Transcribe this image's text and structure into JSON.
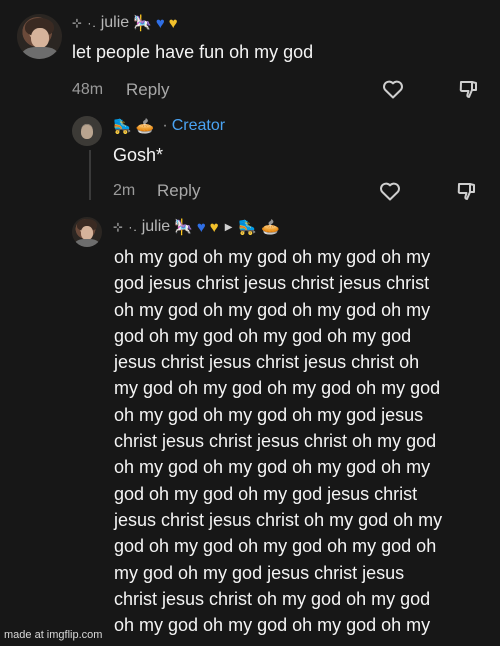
{
  "comments": [
    {
      "username": "julie",
      "badge": "",
      "text": "let people have fun oh my god",
      "time": "48m",
      "reply_label": "Reply"
    },
    {
      "username": "",
      "badge": "Creator",
      "text": "Gosh*",
      "time": "2m",
      "reply_label": "Reply"
    },
    {
      "username": "julie",
      "badge": "",
      "text": "oh my god oh my god oh my god oh my\ngod jesus christ jesus christ jesus christ\noh my god oh my god oh my god oh my\ngod oh my god oh my god oh my god\njesus christ jesus christ jesus christ oh\nmy god oh my god oh my god oh my god\noh my god oh my god oh my god jesus\nchrist jesus christ jesus christ oh my god\noh my god oh my god oh my god oh my\ngod oh my god oh my god jesus christ\njesus christ jesus christ oh my god oh my\ngod oh my god oh my god oh my god oh\nmy god oh my god jesus christ jesus\nchrist jesus christ oh my god oh my god\noh my god oh my god oh my god oh my"
    }
  ],
  "icons": {
    "like": "heart-outline-icon",
    "dislike": "thumbs-down-icon",
    "reply_arrow": "triangle-right-icon"
  },
  "colors": {
    "background": "#171717",
    "creator_badge": "#4aa3f2",
    "text": "#f4f4f4",
    "meta": "#9a9a9a"
  },
  "watermark": "made at imgflip.com"
}
